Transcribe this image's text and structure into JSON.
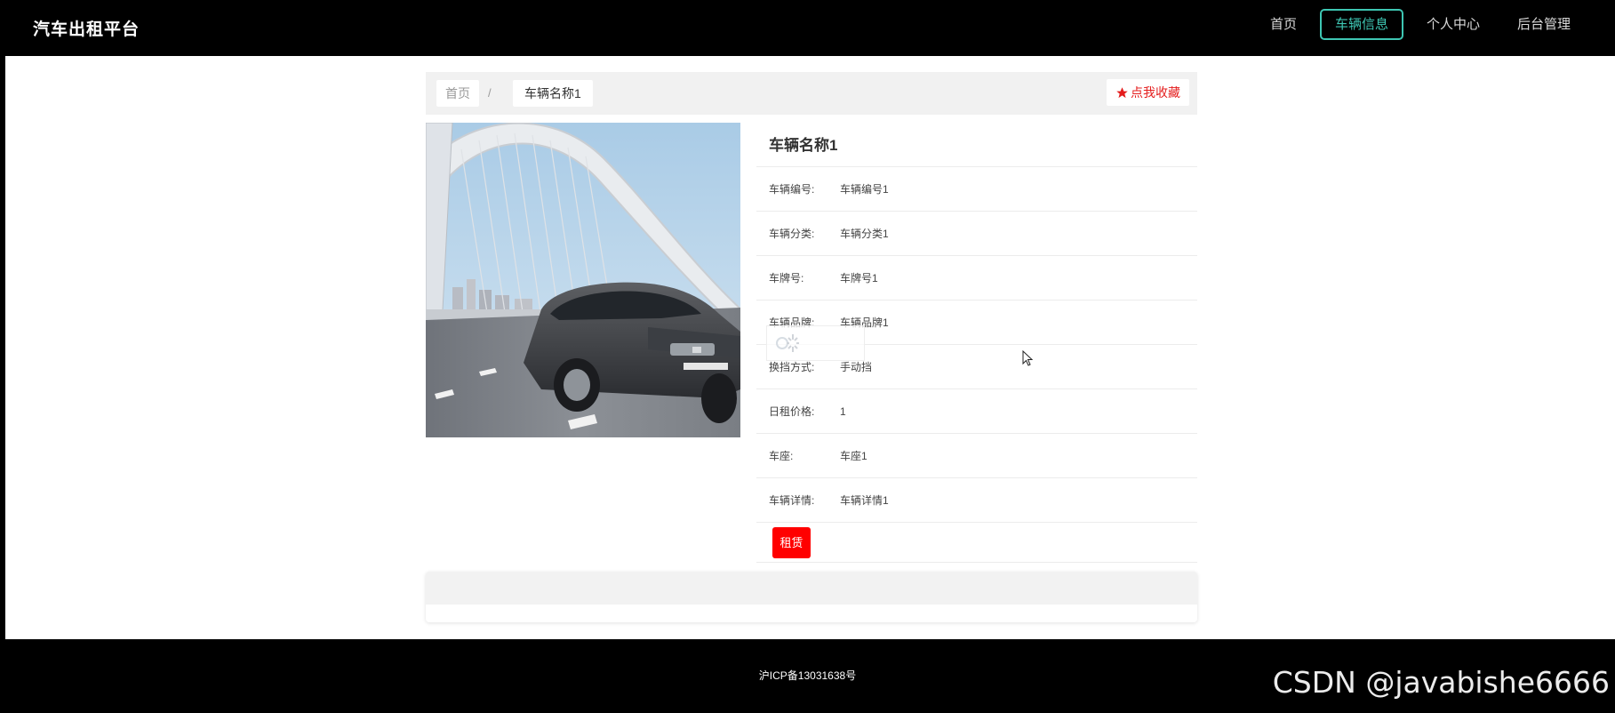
{
  "header": {
    "brand": "汽车出租平台",
    "nav": [
      "首页",
      "车辆信息",
      "个人中心",
      "后台管理"
    ],
    "active_nav": "车辆信息"
  },
  "breadcrumb": {
    "home": "首页",
    "separator": "/",
    "current": "车辆名称1",
    "favorite_label": "点我收藏"
  },
  "car": {
    "name": "车辆名称1",
    "photo_icon": "car-photo-image",
    "fields": [
      {
        "label": "车辆编号:",
        "value": "车辆编号1"
      },
      {
        "label": "车辆分类:",
        "value": "车辆分类1"
      },
      {
        "label": "车牌号:",
        "value": "车牌号1"
      },
      {
        "label": "车辆品牌:",
        "value": "车辆品牌1"
      },
      {
        "label": "换挡方式:",
        "value": "手动挡"
      },
      {
        "label": "日租价格:",
        "value": "1"
      },
      {
        "label": "车座:",
        "value": "车座1"
      },
      {
        "label": "车辆详情:",
        "value": "车辆详情1"
      }
    ],
    "rent_label": "租赁"
  },
  "footer": {
    "icp": "沪ICP备13031638号",
    "watermark": "CSDN @javabishe6666"
  },
  "colors": {
    "accent": "#3ec6b3",
    "rent": "#ff0000",
    "favorite": "#e41c1c"
  }
}
